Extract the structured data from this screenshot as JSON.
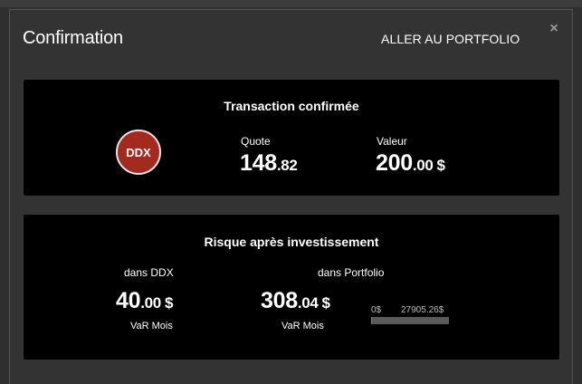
{
  "modal": {
    "title": "Confirmation",
    "portfolio_link": "ALLER AU PORTFOLIO",
    "close_symbol": "×"
  },
  "transaction": {
    "heading": "Transaction confirmée",
    "ticker": "DDX",
    "ticker_color": "#a42a20",
    "quote_label": "Quote",
    "quote_int": "148",
    "quote_frac": ".82",
    "value_label": "Valeur",
    "value_int": "200",
    "value_frac": ".00",
    "value_currency": "$"
  },
  "risk": {
    "heading": "Risque après investissement",
    "ddx": {
      "label": "dans DDX",
      "int": "40",
      "frac": ".00",
      "currency": "$",
      "sub": "VaR Mois"
    },
    "portfolio": {
      "label": "dans Portfolio",
      "int": "308",
      "frac": ".04",
      "currency": "$",
      "sub": "VaR Mois"
    },
    "range_bar": {
      "min_label": "0$",
      "max_label": "27905.26$",
      "fill_fraction": 0.011
    }
  }
}
